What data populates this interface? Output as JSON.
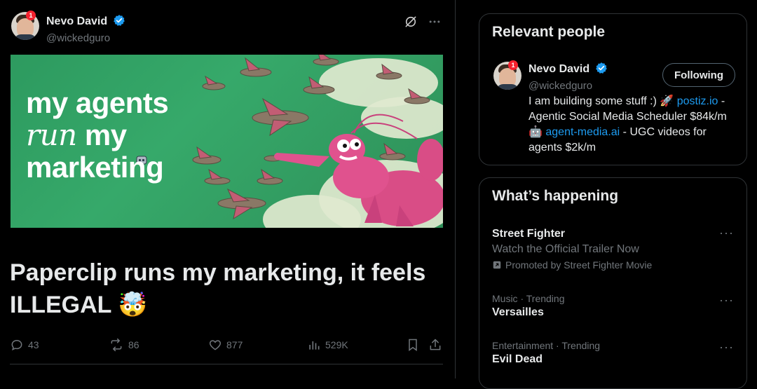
{
  "post": {
    "author_name": "Nevo David",
    "author_handle": "@wickedguro",
    "notification_count": "1",
    "media_text": {
      "line1": "my agents",
      "line2_italic": "run",
      "line2_rest": " my",
      "line3": "marketing"
    },
    "headline": "Paperclip runs my marketing, it feels ILLEGAL 🤯",
    "actions": {
      "replies": "43",
      "reposts": "86",
      "likes": "877",
      "views": "529K"
    }
  },
  "relevant_people": {
    "title": "Relevant people",
    "person": {
      "name": "Nevo David",
      "handle": "@wickedguro",
      "notification_count": "1",
      "follow_label": "Following",
      "bio_part1": "I am building some stuff :) 🚀 ",
      "bio_link1": "postiz.io",
      "bio_part2": " - Agentic Social Media Scheduler $84k/m 🤖 ",
      "bio_link2": "agent-media.ai",
      "bio_part3": " - UGC videos for agents $2k/m"
    }
  },
  "whats_happening": {
    "title": "What’s happening",
    "trends": [
      {
        "title": "Street Fighter",
        "description": "Watch the Official Trailer Now",
        "promoted": "Promoted by Street Fighter Movie"
      },
      {
        "meta": "Music · Trending",
        "title": "Versailles"
      },
      {
        "meta": "Entertainment · Trending",
        "title": "Evil Dead"
      }
    ]
  },
  "colors": {
    "accent": "#1d9bf0",
    "verified": "#1d9bf0",
    "muted": "#71767b",
    "border": "#2f3336"
  },
  "icons": [
    "verified-badge-icon",
    "grok-icon",
    "more-icon",
    "reply-icon",
    "repost-icon",
    "like-icon",
    "views-icon",
    "bookmark-icon",
    "share-icon",
    "promoted-icon"
  ]
}
